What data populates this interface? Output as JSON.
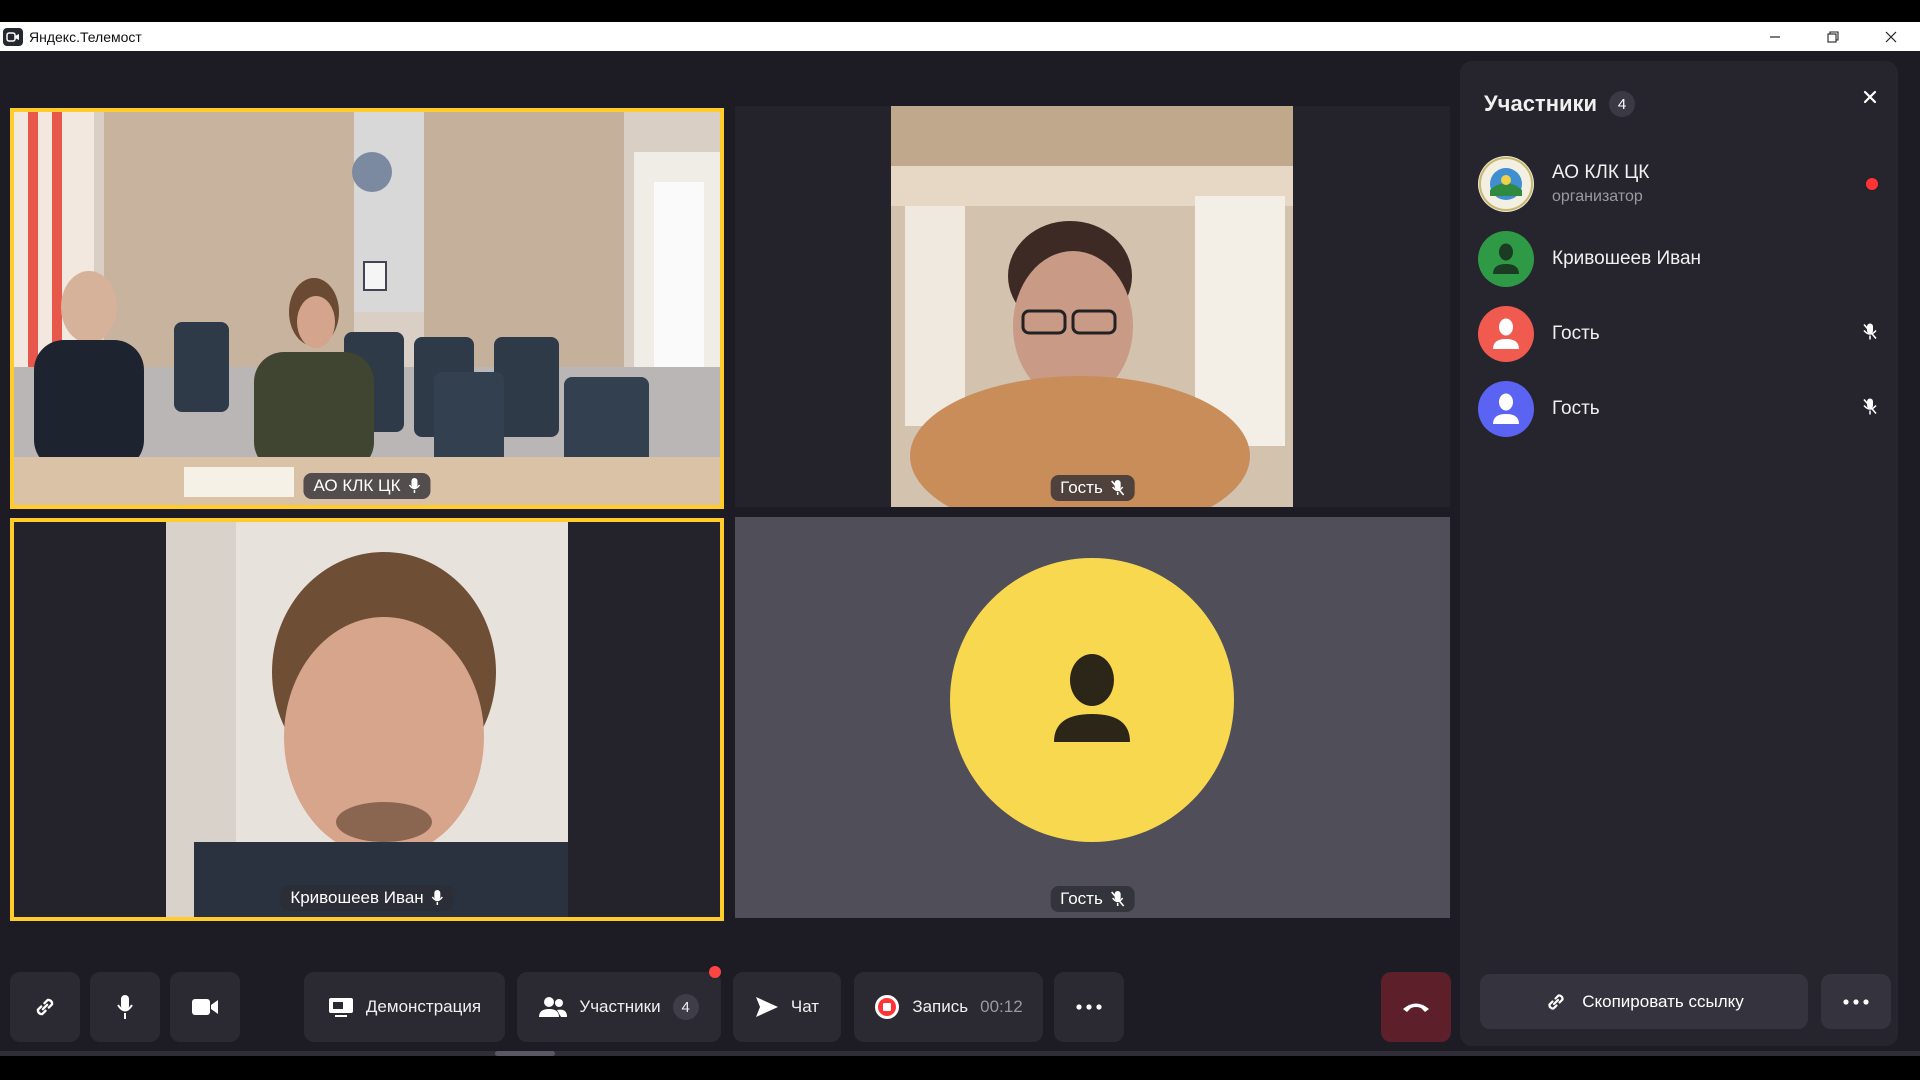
{
  "window": {
    "title": "Яндекс.Телемост",
    "icon": "telemost-app-icon",
    "controls": [
      "minimize-icon",
      "restore-icon",
      "close-icon"
    ]
  },
  "tiles": [
    {
      "name": "АО КЛК ЦК",
      "mic": "mic-on-icon",
      "active": true
    },
    {
      "name": "Гость",
      "mic": "mic-off-icon",
      "active": false
    },
    {
      "name": "Кривошеев Иван",
      "mic": "mic-on-icon",
      "active": true
    },
    {
      "name": "Гость",
      "mic": "mic-off-icon",
      "active": false,
      "avatar_color": "#f8d84f"
    }
  ],
  "participants_panel": {
    "title": "Участники",
    "count": "4",
    "items": [
      {
        "name": "АО КЛК ЦК",
        "role": "организатор",
        "indicator": "recording-dot",
        "avatar": "organization-logo"
      },
      {
        "name": "Кривошеев Иван",
        "role": "",
        "indicator": "",
        "avatar_color": "#2f9a46"
      },
      {
        "name": "Гость",
        "role": "",
        "indicator": "mic-off-icon",
        "avatar_color": "#f05a4f"
      },
      {
        "name": "Гость",
        "role": "",
        "indicator": "mic-off-icon",
        "avatar_color": "#5b63f2"
      }
    ],
    "copy_link_label": "Скопировать ссылку"
  },
  "toolbar": {
    "demo_label": "Демонстрация",
    "participants_label": "Участники",
    "participants_count": "4",
    "chat_label": "Чат",
    "record_label": "Запись",
    "record_time": "00:12"
  },
  "colors": {
    "active_speaker_border": "#ffcc29",
    "end_call": "#5d1f29",
    "record_red": "#f33"
  }
}
